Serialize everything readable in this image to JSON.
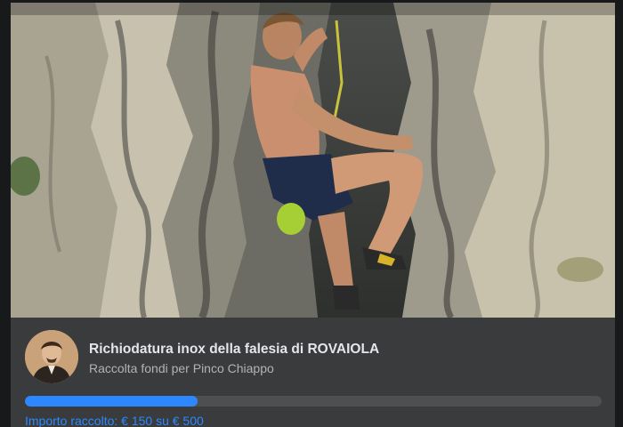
{
  "fundraiser": {
    "title": "Richiodatura inox della falesia di ROVAIOLA",
    "subtitle": "Raccolta fondi per Pinco Chiappo",
    "raised_text": "Importo raccolto: € 150 su € 500",
    "raised_amount": 150,
    "goal_amount": 500,
    "progress_fraction": 0.3
  },
  "colors": {
    "accent": "#2d88ff",
    "card_bg": "#3a3b3c",
    "page_bg": "#18191a",
    "track": "#4e4f50"
  }
}
